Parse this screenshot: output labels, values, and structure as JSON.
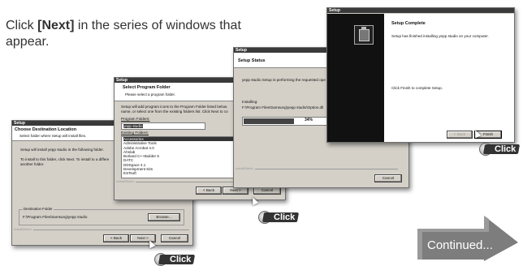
{
  "instruction": {
    "prefix": "Click ",
    "bold": "[Next]",
    "suffix": " in the series of windows that appear."
  },
  "windows": {
    "dest": {
      "title": "Setup",
      "header_title": "Choose Destination Location",
      "header_sub": "Select folder where Setup will install files.",
      "line1": "Setup will install yepp studio in the following folder.",
      "line2": "To install to this folder, click Next. To install to a differe",
      "line3": "another folder.",
      "group_label": "Destination Folder",
      "folder": "F:\\Program Files\\Samsung\\yepp studio",
      "browse": "Browse...",
      "installshield": "InstallShield",
      "back": "< Back",
      "next": "Next >",
      "cancel": "Cancel"
    },
    "program": {
      "title": "Setup",
      "header_title": "Select Program Folder",
      "header_sub": "Please select a program folder.",
      "line1": "Setup will add program icons to the Program Folder listed below.",
      "line2": "name, or select one from the existing folders list. Click Next to co",
      "pf_label": "Program Folders:",
      "pf_value": "yepp studio",
      "ef_label": "Existing Folders:",
      "folders": [
        "Accessories",
        "Administrative Tools",
        "Adobe Acrobat 4.0",
        "Ahnlab",
        "Borland C++Builder 5",
        "DATC",
        "DDSpace 4.1",
        "Development Kits",
        "ESTsoft"
      ],
      "installshield": "InstallShield",
      "back": "< Back",
      "next": "Next >",
      "cancel": "Cancel"
    },
    "status": {
      "title": "Setup",
      "header_title": "Setup Status",
      "line1": "yepp studio Setup is performing the requested ope",
      "installing": "Installing:",
      "path": "F:\\Program Files\\Samsung\\yepp studio\\Option.dll",
      "progress_text": "34%",
      "progress": 0.34,
      "installshield": "InstallShield",
      "cancel": "Cancel"
    },
    "complete": {
      "title": "Setup",
      "header_title": "Setup Complete",
      "line1": "Setup has finished installing yepp studio on your computer.",
      "line2": "Click Finish to complete Setup.",
      "back": "< Back",
      "finish": "Finish"
    }
  },
  "click_label": "Click",
  "continued": "Continued..."
}
